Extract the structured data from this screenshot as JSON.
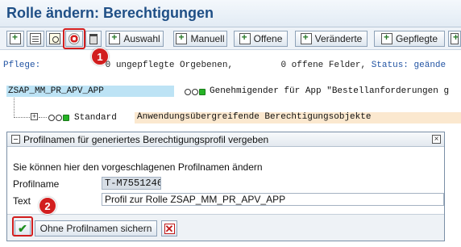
{
  "window": {
    "title": "Rolle ändern: Berechtigungen"
  },
  "toolbar": {
    "buttons": [
      {
        "icon": "add-object-icon"
      },
      {
        "icon": "document-icon"
      },
      {
        "icon": "schedule-icon"
      },
      {
        "icon": "generate-profile-icon"
      },
      {
        "icon": "trash-icon"
      },
      {
        "icon": "add-icon",
        "label": "Auswahl"
      },
      {
        "icon": "add-icon",
        "label": "Manuell"
      },
      {
        "icon": "add-icon",
        "label": "Offene"
      },
      {
        "icon": "add-icon",
        "label": "Veränderte"
      },
      {
        "icon": "add-icon",
        "label": "Gepflegte"
      },
      {
        "icon": "other-icon"
      }
    ]
  },
  "callouts": {
    "one": "1",
    "two": "2"
  },
  "status": {
    "pflege_label": "Pflege:",
    "pflege_count": "0",
    "pflege_text": "ungepflegte Orgebenen,",
    "offene_count": "0",
    "offene_text": "offene Felder,",
    "status_label": "Status: geände"
  },
  "tree": {
    "role_name": "ZSAP_MM_PR_APV_APP",
    "role_description": "Genehmigender für App \"Bestellanforderungen g",
    "child_name": "Standard",
    "child_description": "Anwendungsübergreifende Berechtigungsobjekte"
  },
  "dialog": {
    "title": "Profilnamen für generiertes Berechtigungsprofil vergeben",
    "message": "Sie können hier den vorgeschlagenen Profilnamen ändern",
    "profilname_label": "Profilname",
    "profilname_value": "T-M7551246",
    "text_label": "Text",
    "text_value": "Profil zur Rolle ZSAP_MM_PR_APV_APP",
    "confirm_icon": "check-icon",
    "save_without_label": "Ohne Profilnamen sichern",
    "cancel_icon": "cancel-icon"
  },
  "colors": {
    "title": "#1f4f86",
    "callout": "#d21e1e",
    "role_highlight": "#bde3f5",
    "standard_highlight": "#fbe8cf",
    "status_blue": "#2254a3"
  }
}
